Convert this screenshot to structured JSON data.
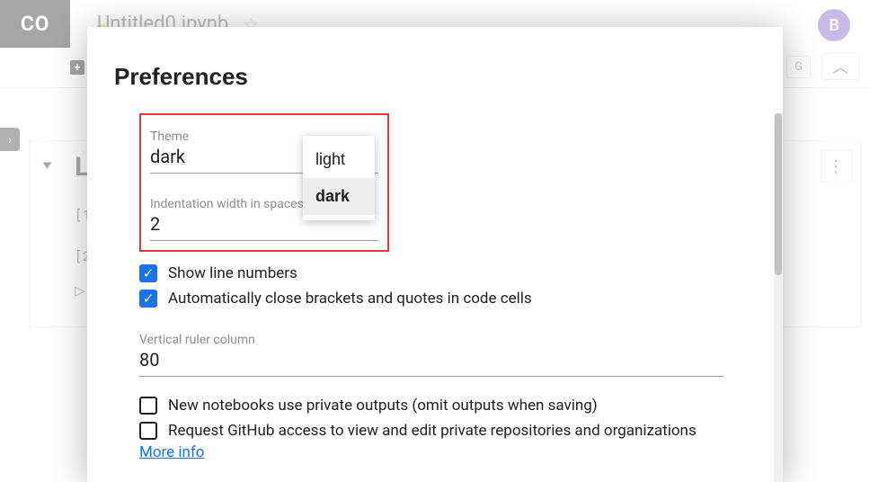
{
  "app": {
    "logo_text": "CO",
    "doc_title": "Untitled0.ipynb",
    "avatar_letter": "B",
    "right_chip": "G",
    "section_title": "Li",
    "cell_label_1": "[1",
    "cell_label_2": "[2",
    "add_glyph": "+"
  },
  "modal": {
    "title": "Preferences",
    "theme_label": "Theme",
    "theme_value": "dark",
    "theme_options": {
      "opt1": "light",
      "opt2": "dark"
    },
    "indent_label": "Indentation width in spaces",
    "indent_value": "2",
    "show_line_numbers_label": "Show line numbers",
    "auto_close_label": "Automatically close brackets and quotes in code cells",
    "ruler_label": "Vertical ruler column",
    "ruler_value": "80",
    "private_outputs_label": "New notebooks use private outputs (omit outputs when saving)",
    "github_access_label": "Request GitHub access to view and edit private repositories and organizations",
    "more_info_label": "More info"
  }
}
